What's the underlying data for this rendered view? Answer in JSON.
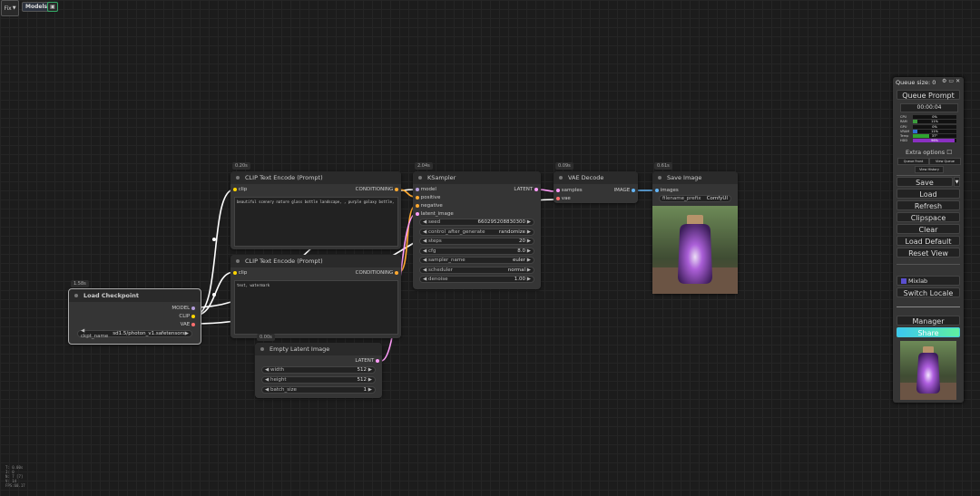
{
  "topbar": {
    "logo_label": "Fix",
    "models_label": "Models",
    "save_icon": "floppy-icon"
  },
  "nodes": {
    "checkpoint": {
      "time": "1.58s",
      "title": "Load Checkpoint",
      "outputs": [
        "MODEL",
        "CLIP",
        "VAE"
      ],
      "widget_name": "ckpt_name",
      "widget_value": "sd1.5/photon_v1.safetensors"
    },
    "clip1": {
      "time": "0.20s",
      "title": "CLIP Text Encode (Prompt)",
      "input": "clip",
      "output": "CONDITIONING",
      "text": "beautiful scenery nature glass bottle landscape, , purple galaxy bottle,"
    },
    "clip2": {
      "title": "CLIP Text Encode (Prompt)",
      "input": "clip",
      "output": "CONDITIONING",
      "text": "text, watermark"
    },
    "latent": {
      "time": "0.00s",
      "title": "Empty Latent Image",
      "output": "LATENT",
      "widgets": [
        {
          "name": "width",
          "value": "512"
        },
        {
          "name": "height",
          "value": "512"
        },
        {
          "name": "batch_size",
          "value": "1"
        }
      ]
    },
    "ksampler": {
      "time": "2.04s",
      "title": "KSampler",
      "inputs": [
        "model",
        "positive",
        "negative",
        "latent_image"
      ],
      "output": "LATENT",
      "widgets": [
        {
          "name": "seed",
          "value": "660295208830300"
        },
        {
          "name": "control_after_generate",
          "value": "randomize"
        },
        {
          "name": "steps",
          "value": "20"
        },
        {
          "name": "cfg",
          "value": "8.0"
        },
        {
          "name": "sampler_name",
          "value": "euler"
        },
        {
          "name": "scheduler",
          "value": "normal"
        },
        {
          "name": "denoise",
          "value": "1.00"
        }
      ]
    },
    "vae": {
      "time": "0.09s",
      "title": "VAE Decode",
      "inputs": [
        "samples",
        "vae"
      ],
      "output": "IMAGE"
    },
    "save": {
      "time": "0.61s",
      "title": "Save Image",
      "input": "images",
      "widget_name": "filename_prefix",
      "widget_value": "ComfyUI"
    }
  },
  "panel": {
    "queue_size": "Queue size: 0",
    "queue_prompt": "Queue Prompt",
    "timer": "00:00:04",
    "monitors": [
      {
        "name": "CPU",
        "value": "0%",
        "percent": 0,
        "color": "#3c9b3c"
      },
      {
        "name": "RAM",
        "value": "11%",
        "percent": 11,
        "color": "#3c9b3c"
      },
      {
        "name": "GPU",
        "value": "0%",
        "percent": 0,
        "color": "#3c9b3c"
      },
      {
        "name": "VRAM",
        "value": "11%",
        "percent": 11,
        "color": "#2f6fd0"
      },
      {
        "name": "Temp",
        "value": "37°",
        "percent": 37,
        "color": "#2fa32f"
      },
      {
        "name": "HDD",
        "value": "96%",
        "percent": 96,
        "color": "#8a2fc2"
      }
    ],
    "extra_options": "Extra options",
    "queue_front": "Queue Front",
    "view_queue": "View Queue",
    "view_history": "View History",
    "buttons": [
      "Save",
      "Load",
      "Refresh",
      "Clipspace",
      "Clear",
      "Load Default",
      "Reset View"
    ],
    "mixlab": "Mixlab",
    "switch_locale": "Switch Locale",
    "manager": "Manager",
    "share": "Share"
  },
  "stats": [
    "T: 0.00s",
    "I: 0",
    "N: 7 [7]",
    "V: 14",
    "FPS:60.17"
  ]
}
